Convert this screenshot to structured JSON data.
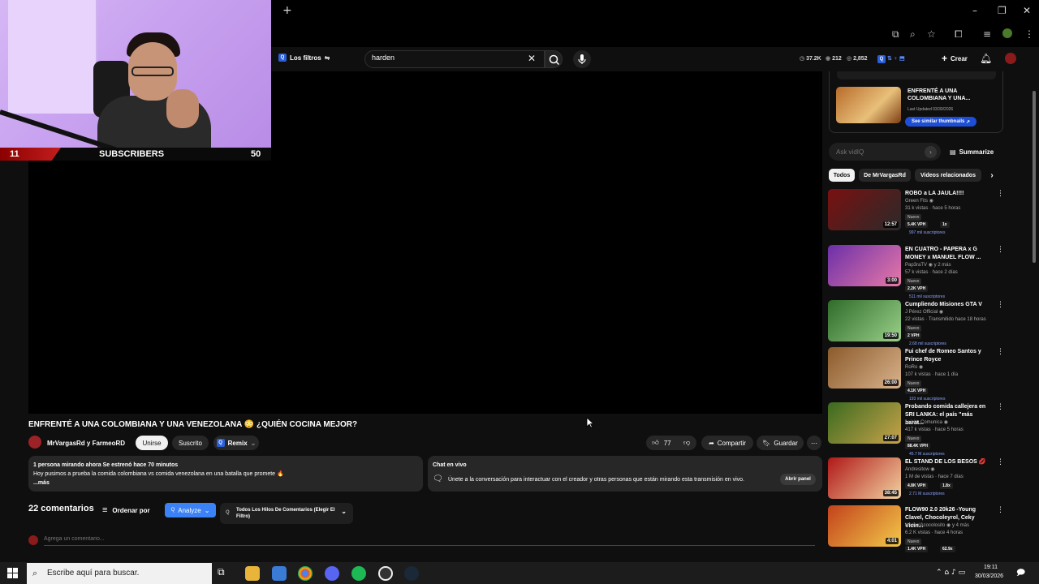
{
  "browser": {
    "new_tab": "+",
    "window_controls": [
      "–",
      "❐",
      "✕"
    ]
  },
  "header": {
    "filters_label": "Los filtros",
    "search_value": "harden",
    "stats": [
      "37.2K",
      "212",
      "2,852"
    ],
    "create_label": "Crear"
  },
  "webcam": {
    "left_number": "11",
    "label": "SUBSCRIBERS",
    "right_number": "50"
  },
  "video": {
    "title": "ENFRENTÉ A UNA COLOMBIANA Y UNA VENEZOLANA 😳 ¿QUIÉN COCINA MEJOR?",
    "channel": "MrVargasRd y FarmeoRD",
    "join_label": "Unirse",
    "subscribed_label": "Suscrito",
    "remix_label": "Remix",
    "likes": "77",
    "share_label": "Compartir",
    "save_label": "Guardar"
  },
  "description": {
    "line1": "1 persona mirando ahora  Se estrenó hace 70 minutos",
    "line2": "Hoy pusimos a prueba la comida colombiana vs comida venezolana en una batalla que promete 🔥",
    "more": "...más"
  },
  "chat": {
    "title": "Chat en vivo",
    "text": "Únete a la conversación para interactuar con el creador y otras personas que están mirando esta transmisión en vivo.",
    "open_panel": "Abrir panel"
  },
  "comments": {
    "count_label": "22 comentarios",
    "sort_label": "Ordenar por",
    "analyze_label": "Analyze",
    "thread_select": "Todos Los Hilos De Comentarios (Elegir El Filtro)",
    "add_placeholder": "Agrega un comentario..."
  },
  "sidebar": {
    "vidiq_title": "ENFRENTÉ A UNA COLOMBIANA Y UNA...",
    "vidiq_updated": "Last Updated 03/30/2026",
    "vidiq_similar": "See similar thumbnails",
    "ask_placeholder": "Ask vidIQ",
    "summarize_label": "Summarize",
    "chips": [
      "Todos",
      "De MrVargasRd",
      "Videos relacionados"
    ],
    "recommendations": [
      {
        "title": "ROBO a LA JAULA!!!!",
        "channel": "Green Fits",
        "meta": "31 k vistas · hace 5 horas",
        "duration": "12:57",
        "badge": "Nuevo",
        "vph": "5.4K VPH",
        "extra": "1x",
        "subs": "997 mil suscriptores",
        "color1": "#7a1010",
        "color2": "#2a2a2a"
      },
      {
        "title": "EN CUATRO - PAPERA x G MONEY x MANUEL FLOW ...",
        "channel": "Pap3raTV",
        "meta": "57 k vistas · hace 2 días",
        "channel_suffix": "y 2 más",
        "duration": "3:00",
        "badge": "Nuevo",
        "vph": "2.2K VPH",
        "extra": "",
        "subs": "511 mil suscriptores",
        "color1": "#6b2fa8",
        "color2": "#e879a8"
      },
      {
        "title": "Cumpliendo Misiones GTA V",
        "channel": "J Pérez Official",
        "meta": "22 vistas · Transmitido hace 18 horas",
        "duration": "19:50",
        "badge": "Nuevo",
        "vph": "2 VPH",
        "extra": "",
        "subs": "2.68 mil suscriptores",
        "color1": "#2f6b2a",
        "color2": "#9ad18a"
      },
      {
        "title": "Fui chef de Romeo Santos y Prince Royce",
        "channel": "RoRo",
        "meta": "107 k vistas · hace 1 día",
        "duration": "26:00",
        "badge": "Nuevo",
        "vph": "4.1K VPH",
        "extra": "",
        "subs": "193 mil suscriptores",
        "color1": "#8b5a2b",
        "color2": "#d9b38c"
      },
      {
        "title": "Probando comida callejera en SRI LANKA: el país \"más barat...",
        "channel": "Luisito Comunica",
        "meta": "417 k vistas · hace 5 horas",
        "duration": "27:07",
        "badge": "Nuevo",
        "vph": "88.4K VPH",
        "extra": "",
        "subs": "45.7 M suscriptores",
        "color1": "#3a6b1f",
        "color2": "#c9a24a"
      },
      {
        "title": "EL STAND DE LOS BESOS 💋",
        "channel": "Andresitow",
        "meta": "1 M de vistas · hace 7 días",
        "duration": "38:45",
        "badge": "",
        "vph": "4.8K VPH",
        "extra": "1.8x",
        "subs": "2.71 M suscriptores",
        "color1": "#b01818",
        "color2": "#f2d2a0"
      },
      {
        "title": "FLOW90 2.0 20k26 -Young Clavel, Chocoleyrol, Ceky Vicin...",
        "channel": "HanselAcocolosito",
        "channel_suffix": "y 4 más",
        "meta": "6.2 K vistas · hace 4 horas",
        "duration": "4:01",
        "badge": "Nuevo",
        "vph": "1.4K VPH",
        "extra": "62.9x",
        "subs": "",
        "color1": "#c2421b",
        "color2": "#f3c84a"
      }
    ]
  },
  "taskbar": {
    "search_placeholder": "Escribe aquí para buscar.",
    "time": "19:11",
    "date": "30/03/2026"
  },
  "colors": {
    "background": "#0f0f0f",
    "accent_blue": "#3b82f6",
    "vidiq_blue": "#1d4ed8"
  }
}
